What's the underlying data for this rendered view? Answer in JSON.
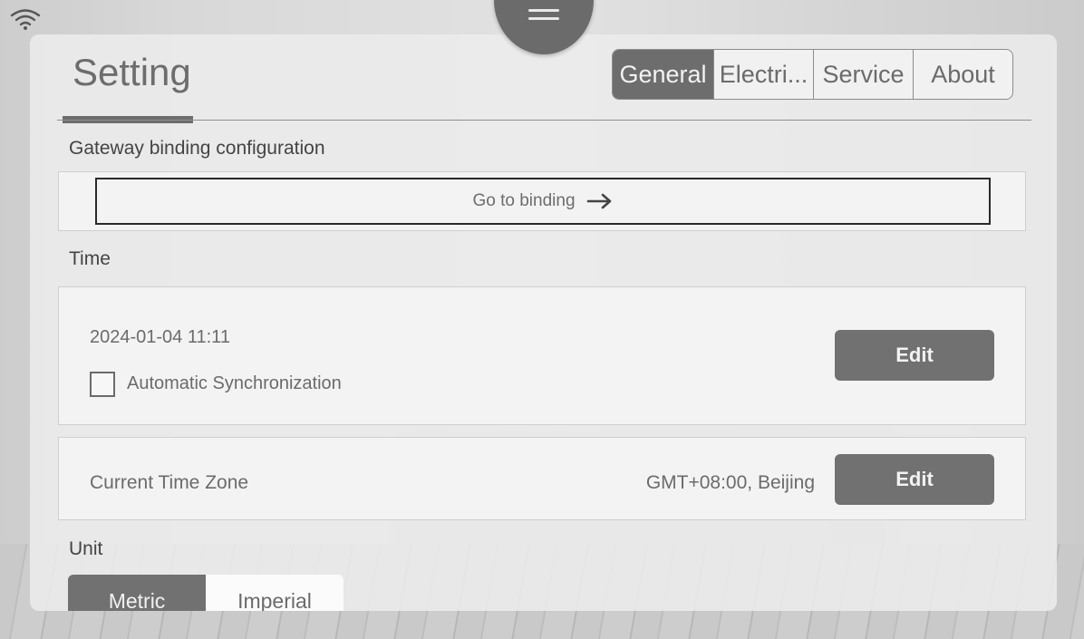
{
  "header": {
    "title": "Setting",
    "tabs": [
      {
        "label": "General",
        "active": true
      },
      {
        "label": "Electri...",
        "active": false
      },
      {
        "label": "Service",
        "active": false
      },
      {
        "label": "About",
        "active": false
      }
    ]
  },
  "sections": {
    "gateway": {
      "label": "Gateway binding configuration",
      "button_label": "Go to binding"
    },
    "time": {
      "label": "Time",
      "value": "2024-01-04 11:11",
      "auto_sync_label": "Automatic Synchronization",
      "auto_sync_checked": false,
      "edit_label": "Edit"
    },
    "timezone": {
      "label": "Current Time Zone",
      "value": "GMT+08:00, Beijing",
      "edit_label": "Edit"
    },
    "unit": {
      "label": "Unit",
      "options": [
        {
          "label": "Metric",
          "selected": true
        },
        {
          "label": "Imperial",
          "selected": false
        }
      ]
    }
  },
  "icons": {
    "wifi": "wifi-icon",
    "menu": "menu-icon",
    "arrow": "arrow-right-icon"
  },
  "colors": {
    "accent": "#6d6d6d",
    "panel": "#ececec"
  }
}
